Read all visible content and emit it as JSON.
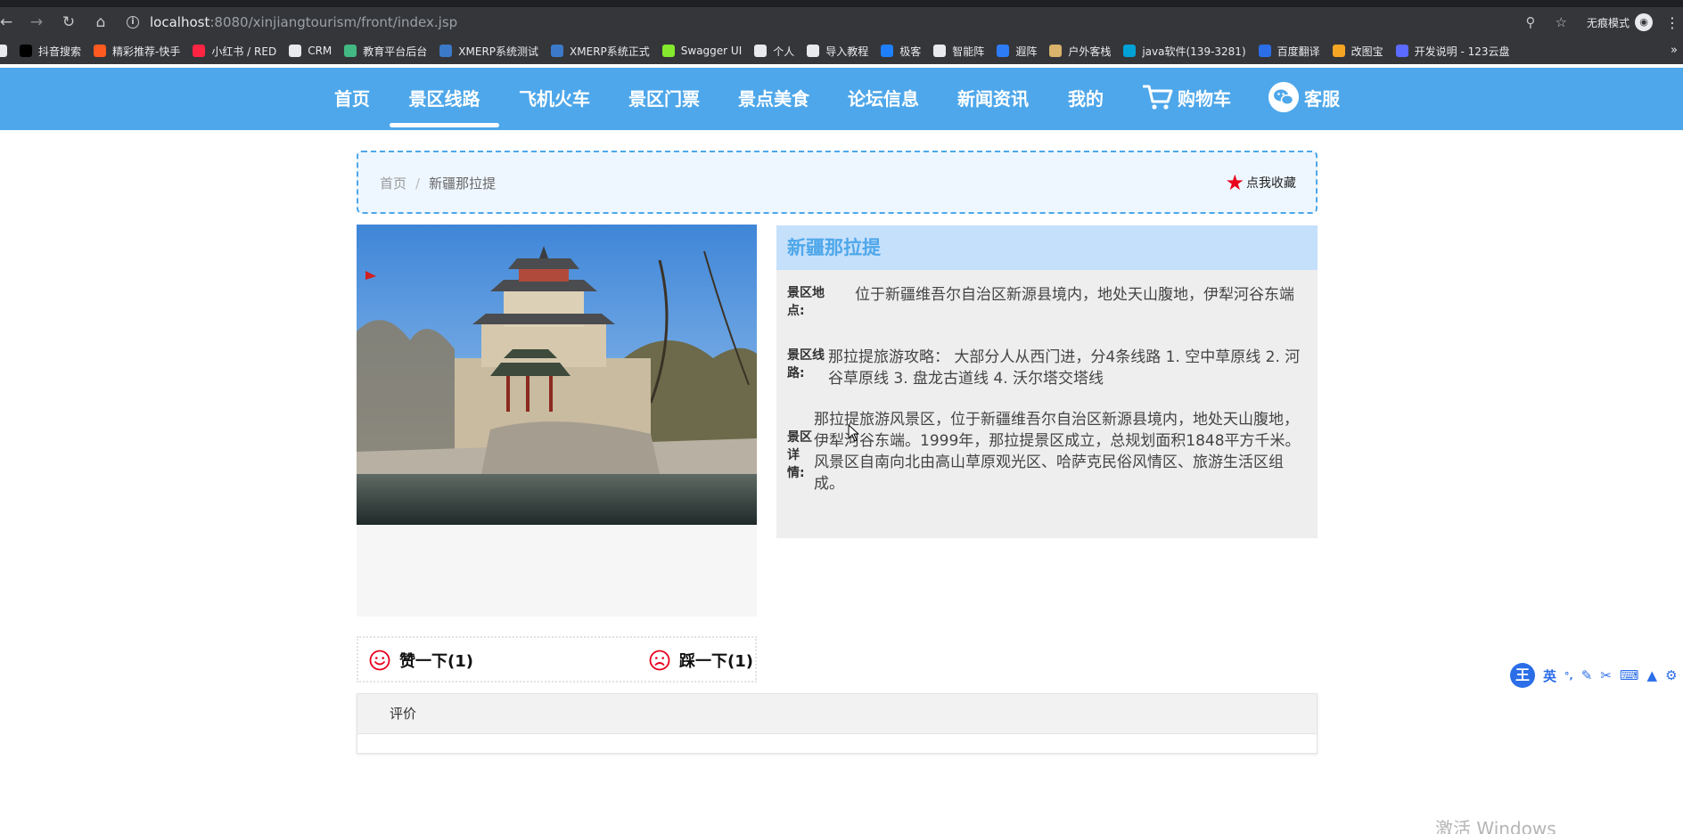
{
  "browser": {
    "url_host": "localhost",
    "url_path": ":8080/xinjiangtourism/front/index.jsp",
    "incognito_label": "无痕模式",
    "bookmarks": [
      {
        "label": "抖音搜索",
        "color": "#000000",
        "icon": "douyin-icon"
      },
      {
        "label": "精彩推荐-快手",
        "color": "#ff5a1f",
        "icon": "kuaishou-icon"
      },
      {
        "label": "小红书 / RED",
        "color": "#ff2442",
        "icon": "xiaohongshu-icon"
      },
      {
        "label": "CRM",
        "color": "#e8eaed",
        "icon": "globe-icon"
      },
      {
        "label": "教育平台后台",
        "color": "#42b883",
        "icon": "vue-icon"
      },
      {
        "label": "XMERP系统测试",
        "color": "#3c7ac9",
        "icon": "erp-icon"
      },
      {
        "label": "XMERP系统正式",
        "color": "#3c7ac9",
        "icon": "erp-icon"
      },
      {
        "label": "Swagger UI",
        "color": "#85ea2d",
        "icon": "swagger-icon"
      },
      {
        "label": "个人",
        "color": "#e8eaed",
        "icon": "globe-icon"
      },
      {
        "label": "导入教程",
        "color": "#e8eaed",
        "icon": "globe-icon"
      },
      {
        "label": "极客",
        "color": "#1e80ff",
        "icon": "juejin-icon"
      },
      {
        "label": "智能阵",
        "color": "#e8eaed",
        "icon": "globe-icon"
      },
      {
        "label": "遐阵",
        "color": "#2d7cf6",
        "icon": "shield-icon"
      },
      {
        "label": "户外客栈",
        "color": "#d9b36b",
        "icon": "inn-icon"
      },
      {
        "label": "java软件(139-3281)",
        "color": "#00a1d6",
        "icon": "bilibili-icon"
      },
      {
        "label": "百度翻译",
        "color": "#2b6ee8",
        "icon": "translate-icon"
      },
      {
        "label": "改图宝",
        "color": "#f5a623",
        "icon": "image-icon"
      },
      {
        "label": "开发说明 - 123云盘",
        "color": "#5b6bff",
        "icon": "cloud-icon"
      }
    ]
  },
  "nav": {
    "items": [
      {
        "label": "首页"
      },
      {
        "label": "景区线路"
      },
      {
        "label": "飞机火车"
      },
      {
        "label": "景区门票"
      },
      {
        "label": "景点美食"
      },
      {
        "label": "论坛信息"
      },
      {
        "label": "新闻资讯"
      },
      {
        "label": "我的"
      },
      {
        "label": "购物车"
      },
      {
        "label": "客服"
      }
    ],
    "active_index": 1
  },
  "breadcrumb": {
    "home": "首页",
    "separator": "/",
    "current": "新疆那拉提"
  },
  "favorite_label": "点我收藏",
  "detail": {
    "title": "新疆那拉提",
    "location_label": "景区地点:",
    "location": "位于新疆维吾尔自治区新源县境内，地处天山腹地，伊犁河谷东端",
    "route_label": "景区线路:",
    "route": "那拉提旅游攻略：  大部分人从西门进，分4条线路 1. 空中草原线 2. 河谷草原线 3. 盘龙古道线 4. 沃尔塔交塔线",
    "details_label": "景区详情:",
    "details": "那拉提旅游风景区，位于新疆维吾尔自治区新源县境内，地处天山腹地，伊犁河谷东端。1999年，那拉提景区成立，总规划面积1848平方千米。风景区自南向北由高山草原观光区、哈萨克民俗风情区、旅游生活区组成。"
  },
  "votes": {
    "like_label": "赞一下(1)",
    "dislike_label": "踩一下(1)"
  },
  "review": {
    "header": "评价"
  },
  "ime": {
    "logo": "王",
    "mode": "英"
  },
  "watermark": "激活 Windows",
  "colors": {
    "nav_bg": "#4ea7ea",
    "accent": "#4ea7ea",
    "star": "#e8001c",
    "smile": "#e8001c"
  }
}
